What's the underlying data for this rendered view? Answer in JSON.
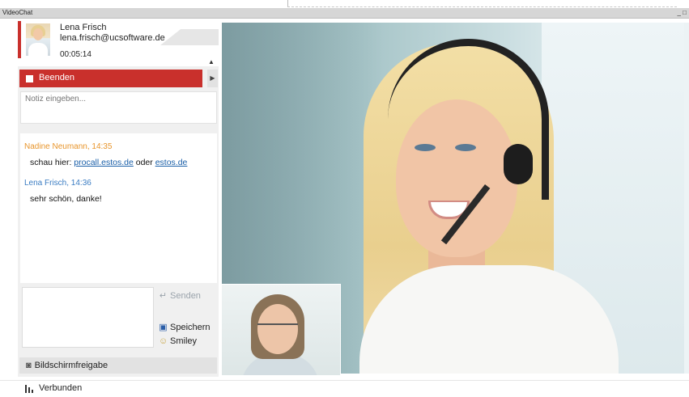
{
  "window": {
    "title": "VideoChat",
    "controls": "_ □"
  },
  "contact": {
    "name": "Lena Frisch",
    "email": "lena.frisch@ucsoftware.de",
    "duration": "00:05:14"
  },
  "call": {
    "end_label": "Beenden"
  },
  "note": {
    "placeholder": "Notiz eingeben..."
  },
  "chat": {
    "messages": [
      {
        "header": "Nadine Neumann, 14:35",
        "color": "#e8952b",
        "text_prefix": "schau hier: ",
        "link1": "procall.estos.de",
        "text_middle": " oder ",
        "link2": "estos.de"
      },
      {
        "header": "Lena Frisch, 14:36",
        "color": "#3a7cc2",
        "text": "sehr schön, danke!"
      }
    ]
  },
  "compose": {
    "value": "",
    "send_label": "Senden",
    "save_label": "Speichern",
    "smiley_label": "Smiley"
  },
  "screenshare": {
    "label": "Bildschirmfreigabe"
  },
  "status": {
    "label": "Verbunden"
  },
  "colors": {
    "accent_red": "#c9302c",
    "link_blue": "#1a5fa8"
  },
  "icons": {
    "send": "send-arrow-icon",
    "save": "floppy-disk-icon",
    "smiley": "smiley-icon",
    "screenshare": "binoculars-icon",
    "status": "signal-bars-icon",
    "end_call": "stop-square-icon"
  }
}
